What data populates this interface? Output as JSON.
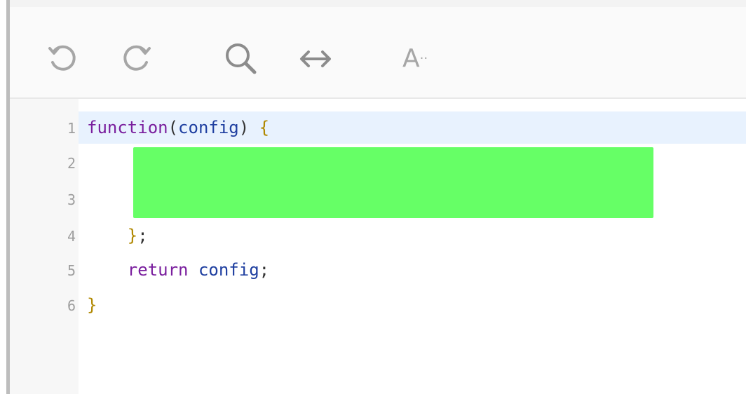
{
  "toolbar": {
    "font_label": "A",
    "font_dots": "··",
    "icons": [
      "undo-icon",
      "redo-icon",
      "search-icon",
      "wrap-icon",
      "font-size-icon"
    ]
  },
  "editor": {
    "line_numbers": [
      "1",
      "2",
      "3",
      "4",
      "5",
      "6"
    ],
    "lines": [
      {
        "segments": [
          {
            "text": "function",
            "kind": "kw"
          },
          {
            "text": "(",
            "kind": "punct"
          },
          {
            "text": "config",
            "kind": "var"
          },
          {
            "text": ") ",
            "kind": "punct"
          },
          {
            "text": "{",
            "kind": "brace"
          }
        ]
      },
      {
        "segments": []
      },
      {
        "segments": []
      },
      {
        "segments": [
          {
            "text": "    }",
            "kind": "brace"
          },
          {
            "text": ";",
            "kind": "punct"
          }
        ]
      },
      {
        "segments": [
          {
            "text": "    return",
            "kind": "kw"
          },
          {
            "text": " ",
            "kind": "punct"
          },
          {
            "text": "config",
            "kind": "var"
          },
          {
            "text": ";",
            "kind": "punct"
          }
        ]
      },
      {
        "segments": [
          {
            "text": "}",
            "kind": "brace"
          }
        ]
      }
    ],
    "highlight_color": "#66ff66",
    "active_line_color": "#e8f2fe"
  }
}
